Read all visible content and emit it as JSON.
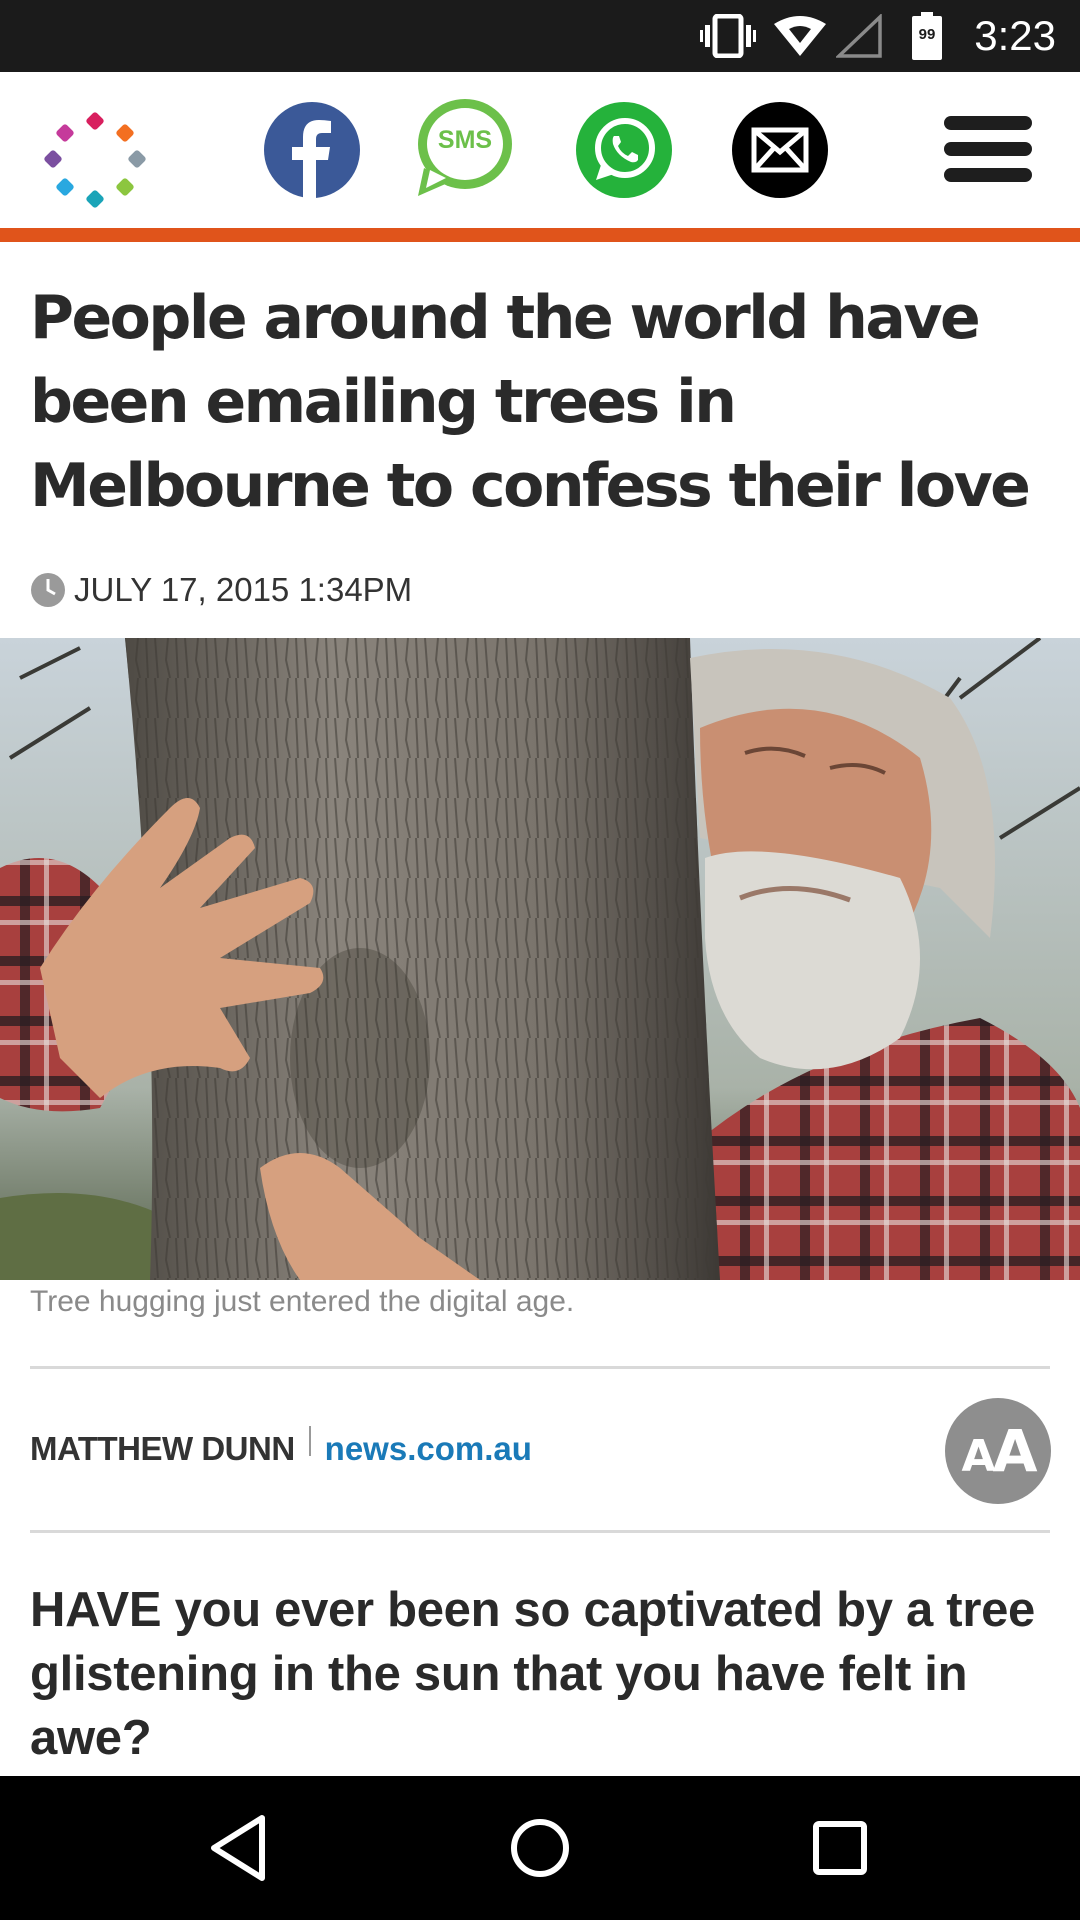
{
  "status_bar": {
    "time": "3:23",
    "battery_level": "99",
    "icons": [
      "vibrate-icon",
      "wifi-icon",
      "cell-signal-icon",
      "battery-icon"
    ]
  },
  "header": {
    "logo": "site-logo",
    "share_buttons": [
      {
        "name": "facebook",
        "label": "",
        "color": "#3b5998"
      },
      {
        "name": "sms",
        "label": "SMS",
        "color": "#6cc04a"
      },
      {
        "name": "whatsapp",
        "label": "",
        "color": "#25b23b"
      },
      {
        "name": "email",
        "label": "",
        "color": "#000000"
      }
    ],
    "accent_color": "#e0541b"
  },
  "article": {
    "headline": "People around the world have been emailing trees in Melbourne to confess their love",
    "date": "JULY 17, 2015 1:34PM",
    "image_caption": "Tree hugging just entered the digital age.",
    "author": "MATTHEW DUNN",
    "source": "news.com.au",
    "source_color": "#1a7ab8",
    "text_size_button": {
      "small": "A",
      "large": "A"
    },
    "intro": "HAVE you ever been so captivated by a tree glistening in the sun that you have felt in awe?"
  },
  "navigation_bar": {
    "buttons": [
      "back-icon",
      "home-icon",
      "recents-icon"
    ]
  }
}
